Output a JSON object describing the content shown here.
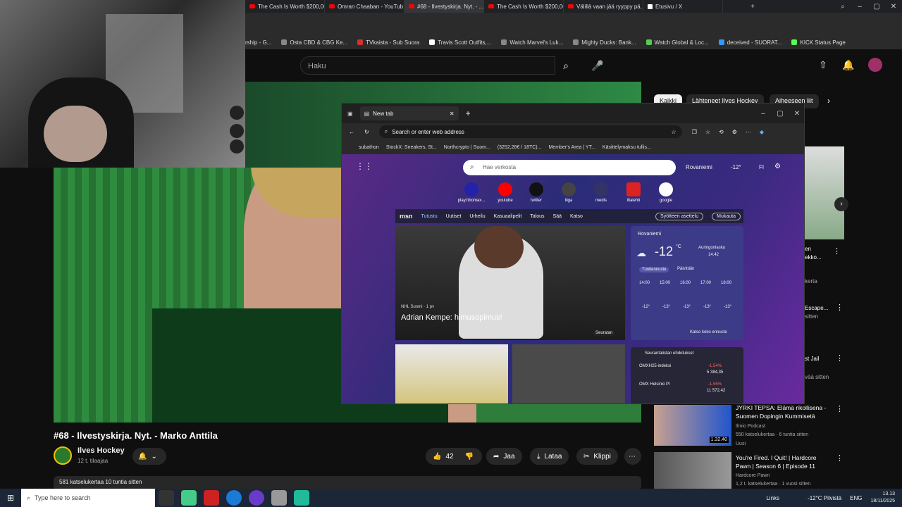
{
  "browser": {
    "tabs": [
      {
        "label": "The Cash Is Worth $200,00..."
      },
      {
        "label": "Omran Chaaban - YouTub..."
      },
      {
        "label": "#68 - Ilvestyskirja. Nyt. - ..."
      },
      {
        "label": "The Cash Is Worth $200,00..."
      },
      {
        "label": "Välillä vaan jää ryyppy pä..."
      },
      {
        "label": "Etusivu / X"
      }
    ],
    "bookmarks": [
      "rship - G...",
      "Osta CBD & CBG Ke...",
      "TVkaista - Sub Suora",
      "Travis Scott Outfits,...",
      "Watch Marvel's Luk...",
      "Mighty Ducks: Bank...",
      "Watch Global & Loc...",
      "deceived - SUORAT...",
      "KICK Status Page"
    ]
  },
  "youtube": {
    "search_placeholder": "Haku",
    "chips": [
      "Kaikki",
      "Lähteneet Ilves Hockey",
      "Aiheeseen liit"
    ],
    "video": {
      "title": "#68 - Ilvestyskirja. Nyt. - Marko Anttila",
      "channel": "Ilves Hockey",
      "subs": "12 t. tilaajaa",
      "likes": "42",
      "share": "Jaa",
      "download": "Lataa",
      "clip": "Klippi",
      "description": "581 katselukertaa  10 tuntia sitten"
    },
    "recs": [
      {
        "title": "en\nekko...",
        "meta": "kerta"
      },
      {
        "title": "Escape...",
        "meta": "sitten"
      },
      {
        "title": "st Jail",
        "meta": "vää sitten"
      },
      {
        "title": "JYRKI TEPSA: Elämä rikollisena - Suomen Dopingin Kummisetä",
        "channel": "Ilmio Podcast",
        "meta": "550 katselukertaa · 6 tuntia sitten",
        "badge": "Uusi",
        "duration": "1.32.40"
      },
      {
        "title": "You're Fired. I Quit! | Hardcore Pawn | Season 6 | Episode 11",
        "channel": "Hardcore Pawn",
        "meta": "1,2 t. katselukertaa · 1 vuosi sitten"
      }
    ]
  },
  "newtab": {
    "tab_title": "New tab",
    "address_placeholder": "Search or enter web address",
    "bookmarks": [
      "subathon",
      "StockX: Sneakers, St...",
      "Northcrypto | Suom...",
      "(3252,26€ / 18TC)...",
      "Member's Area | YT...",
      "Käsittelymaksu tullis..."
    ],
    "search_placeholder": "Hae verkosta",
    "weather_top": "Rovaniemi",
    "temp_top": "-12°",
    "lang": "FI",
    "quicklinks": [
      "play.hbomax...",
      "youtube",
      "twitter",
      "liiga",
      "medis",
      "iltalehti",
      "google"
    ],
    "msn": "msn",
    "msn_tabs": [
      "Tutustu",
      "Uutiset",
      "Urheilu",
      "Kasuaalipelit",
      "Talous",
      "Sää",
      "Katso"
    ],
    "msn_buttons": [
      "Syötteen asettelu",
      "Mukauta"
    ],
    "headline": "Adrian Kempe: himusopimus!",
    "headline_source": "NHL Suomi · 1 pv",
    "follow": "Seuratan",
    "weather": {
      "city": "Rovaniemi",
      "temp": "-12",
      "unit": "°C",
      "sunrise": "Auringonlasku",
      "sunrise_time": "14.42",
      "tabs": [
        "Tuntiennuste",
        "Päivittäin"
      ],
      "hours": [
        "14:00",
        "15:00",
        "16:00",
        "17:00",
        "18:00"
      ],
      "temps": [
        "-12°",
        "-13°",
        "-13°",
        "-13°",
        "-13°"
      ],
      "more": "Katso koko ennuste"
    },
    "watchlist": {
      "title": "Seurantalistan ehdotukset",
      "items": [
        {
          "name": "OMXH25-indeksi",
          "change": "-1.54%",
          "value": "5 384,35"
        },
        {
          "name": "OMX Helsinki PI",
          "change": "-1.55%",
          "value": "11 572,42"
        }
      ]
    }
  },
  "taskbar": {
    "search_placeholder": "Type here to search",
    "links": "Links",
    "weather": "-12°C Pilvistä",
    "lang": "ENG",
    "time": "13.13",
    "date": "18/11/2025"
  }
}
